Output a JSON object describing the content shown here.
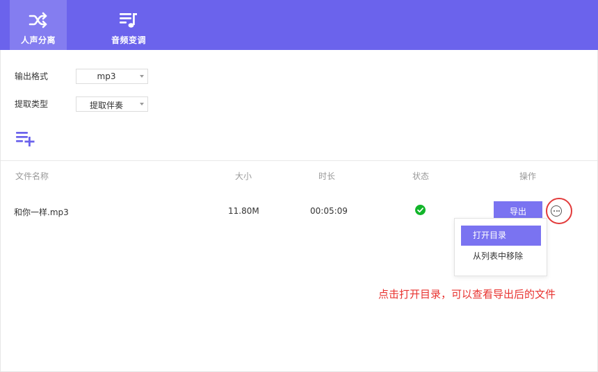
{
  "header": {
    "tabs": [
      {
        "label": "人声分离",
        "icon": "shuffle-icon",
        "active": true
      },
      {
        "label": "音频变调",
        "icon": "music-list-icon",
        "active": false
      }
    ],
    "accent_color": "#6b63ec"
  },
  "settings": {
    "output_format": {
      "label": "输出格式",
      "value": "mp3"
    },
    "extract_type": {
      "label": "提取类型",
      "value": "提取伴奏"
    },
    "add_files_icon": "playlist-add-icon"
  },
  "table": {
    "columns": [
      "文件名称",
      "大小",
      "时长",
      "状态",
      "操作"
    ],
    "rows": [
      {
        "name": "和你一样.mp3",
        "size": "11.80M",
        "duration": "00:05:09",
        "status": "success",
        "action": "导出"
      }
    ]
  },
  "context_menu": {
    "items": [
      {
        "label": "打开目录",
        "active": true
      },
      {
        "label": "从列表中移除",
        "active": false
      }
    ]
  },
  "annotation": "点击打开目录，可以查看导出后的文件",
  "colors": {
    "primary": "#6b63ec",
    "button": "#7a73f1",
    "success": "#12b52a",
    "annotation": "#e8322f"
  }
}
